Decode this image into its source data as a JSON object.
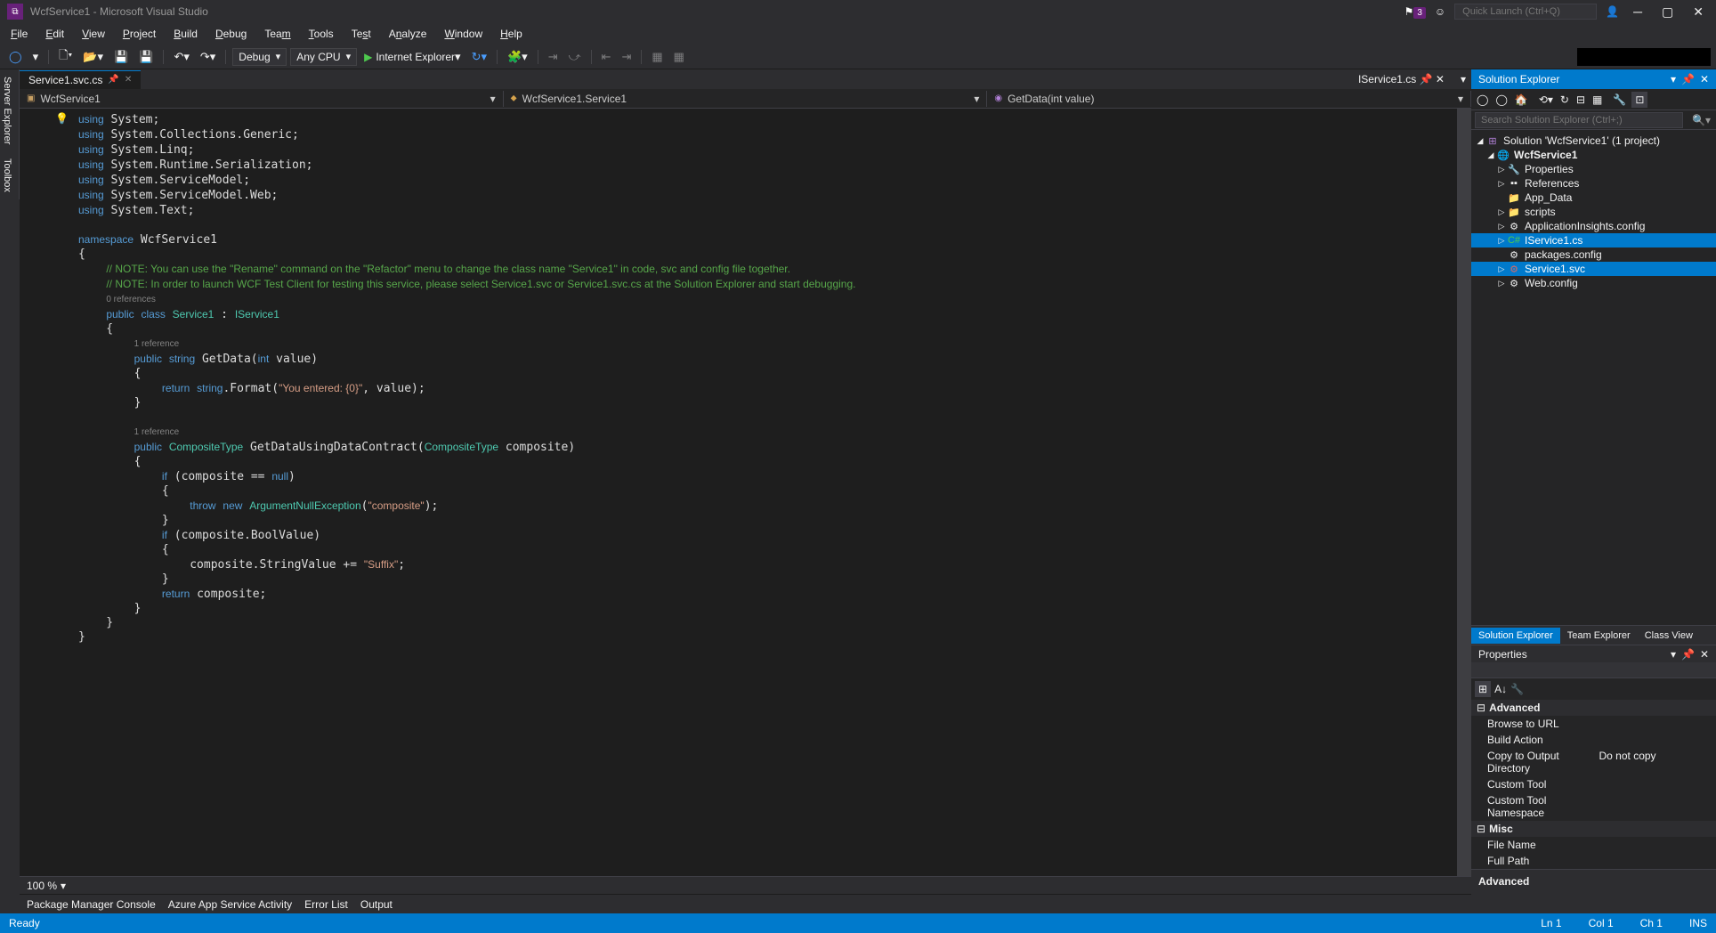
{
  "title": "WcfService1 - Microsoft Visual Studio",
  "notification_count": "3",
  "quick_launch_placeholder": "Quick Launch (Ctrl+Q)",
  "menu": [
    "File",
    "Edit",
    "View",
    "Project",
    "Build",
    "Debug",
    "Team",
    "Tools",
    "Test",
    "Analyze",
    "Window",
    "Help"
  ],
  "toolbar": {
    "config": "Debug",
    "platform": "Any CPU",
    "run_target": "Internet Explorer"
  },
  "active_tab": "Service1.svc.cs",
  "preview_tab": "IService1.cs",
  "nav": {
    "project": "WcfService1",
    "class": "WcfService1.Service1",
    "member": "GetData(int value)"
  },
  "zoom": "100 %",
  "bottom_tabs": [
    "Package Manager Console",
    "Azure App Service Activity",
    "Error List",
    "Output"
  ],
  "solution_explorer": {
    "title": "Solution Explorer",
    "search_placeholder": "Search Solution Explorer (Ctrl+;)",
    "solution": "Solution 'WcfService1' (1 project)",
    "project": "WcfService1",
    "items": [
      "Properties",
      "References",
      "App_Data",
      "scripts",
      "ApplicationInsights.config",
      "IService1.cs",
      "packages.config",
      "Service1.svc",
      "Web.config"
    ],
    "selected": [
      "IService1.cs",
      "Service1.svc"
    ],
    "tabs": [
      "Solution Explorer",
      "Team Explorer",
      "Class View"
    ]
  },
  "properties": {
    "title": "Properties",
    "categories": [
      {
        "name": "Advanced",
        "props": [
          {
            "name": "Browse to URL",
            "value": ""
          },
          {
            "name": "Build Action",
            "value": ""
          },
          {
            "name": "Copy to Output Directory",
            "value": "Do not copy"
          },
          {
            "name": "Custom Tool",
            "value": ""
          },
          {
            "name": "Custom Tool Namespace",
            "value": ""
          }
        ]
      },
      {
        "name": "Misc",
        "props": [
          {
            "name": "File Name",
            "value": ""
          },
          {
            "name": "Full Path",
            "value": ""
          }
        ]
      }
    ],
    "desc_title": "Advanced"
  },
  "status": {
    "ready": "Ready",
    "ln": "Ln 1",
    "col": "Col 1",
    "ch": "Ch 1",
    "ins": "INS"
  },
  "code": {
    "ref0": "0 references",
    "ref1": "1 reference",
    "comment1": "// NOTE: You can use the \"Rename\" command on the \"Refactor\" menu to change the class name \"Service1\" in code, svc and config file together.",
    "comment2": "// NOTE: In order to launch WCF Test Client for testing this service, please select Service1.svc or Service1.svc.cs at the Solution Explorer and start debugging."
  }
}
